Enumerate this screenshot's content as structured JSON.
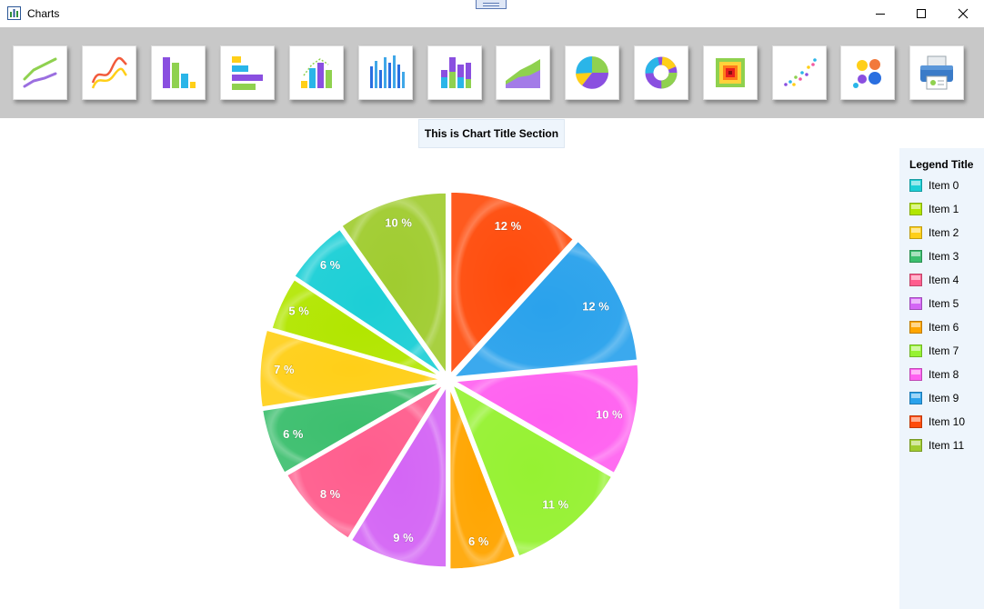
{
  "window": {
    "title": "Charts"
  },
  "toolbar": {
    "buttons": [
      {
        "name": "line-chart-button",
        "icon": "line-chart-icon"
      },
      {
        "name": "spline-chart-button",
        "icon": "spline-chart-icon"
      },
      {
        "name": "column-chart-button",
        "icon": "column-chart-icon"
      },
      {
        "name": "bar-chart-button",
        "icon": "bar-chart-icon"
      },
      {
        "name": "combo-chart-button",
        "icon": "combo-chart-icon"
      },
      {
        "name": "multi-column-chart-button",
        "icon": "multi-column-chart-icon"
      },
      {
        "name": "stacked-column-chart-button",
        "icon": "stacked-column-chart-icon"
      },
      {
        "name": "area-chart-button",
        "icon": "area-chart-icon"
      },
      {
        "name": "pie-chart-button",
        "icon": "pie-chart-icon"
      },
      {
        "name": "donut-chart-button",
        "icon": "donut-chart-icon"
      },
      {
        "name": "heatmap-chart-button",
        "icon": "heatmap-chart-icon"
      },
      {
        "name": "scatter-chart-button",
        "icon": "scatter-chart-icon"
      },
      {
        "name": "bubble-chart-button",
        "icon": "bubble-chart-icon"
      },
      {
        "name": "print-button",
        "icon": "printer-icon"
      }
    ]
  },
  "chart_data": {
    "type": "pie",
    "title": "This is Chart Title Section",
    "legend_title": "Legend Title",
    "legend_position": "right",
    "start_angle_deg": 0,
    "direction": "clockwise",
    "categories": [
      "Item 0",
      "Item 1",
      "Item 2",
      "Item 3",
      "Item 4",
      "Item 5",
      "Item 6",
      "Item 7",
      "Item 8",
      "Item 9",
      "Item 10",
      "Item 11"
    ],
    "values": [
      6,
      5,
      7,
      6,
      8,
      9,
      6,
      11,
      10,
      12,
      12,
      10
    ],
    "value_labels": [
      "6 %",
      "5 %",
      "7 %",
      "6 %",
      "8 %",
      "9 %",
      "6 %",
      "11 %",
      "10 %",
      "12 %",
      "12 %",
      "10 %"
    ],
    "colors": [
      "#1ccfd6",
      "#b2e600",
      "#ffcf18",
      "#3cbf6e",
      "#ff5e8e",
      "#d466f5",
      "#ffa500",
      "#96f232",
      "#ff60f0",
      "#2aa2ec",
      "#ff4c0c",
      "#a0cc30"
    ],
    "draw_order": [
      10,
      9,
      8,
      7,
      6,
      5,
      4,
      3,
      2,
      1,
      0,
      11
    ]
  }
}
